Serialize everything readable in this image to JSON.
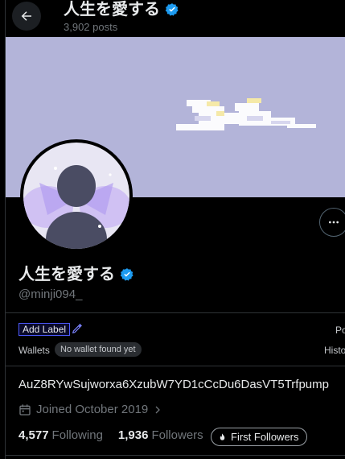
{
  "header": {
    "title": "人生を愛する",
    "posts_count": "3,902 posts"
  },
  "profile": {
    "display_name": "人生を愛する",
    "handle": "@minji094_",
    "bio": "AuZ8RYwSujworxa6XzubW7YD1cCcDu6DasVT5Trfpump",
    "joined": "Joined October 2019",
    "following_count": "4,577",
    "following_label": "Following",
    "followers_count": "1,936",
    "followers_label": "Followers"
  },
  "extension": {
    "add_label": "Add Label",
    "wallets_label": "Wallets",
    "no_wallet": "No wallet found yet",
    "right_text_1": "Po",
    "right_text_2": "Histo",
    "first_followers": "First Followers"
  },
  "colors": {
    "verified": "#1d9bf0",
    "banner": "#b3b4d9",
    "background": "#000000"
  },
  "icons": [
    "back-arrow-icon",
    "verified-badge-icon",
    "more-icon",
    "pencil-icon",
    "calendar-icon",
    "chevron-right-icon",
    "flame-icon"
  ]
}
